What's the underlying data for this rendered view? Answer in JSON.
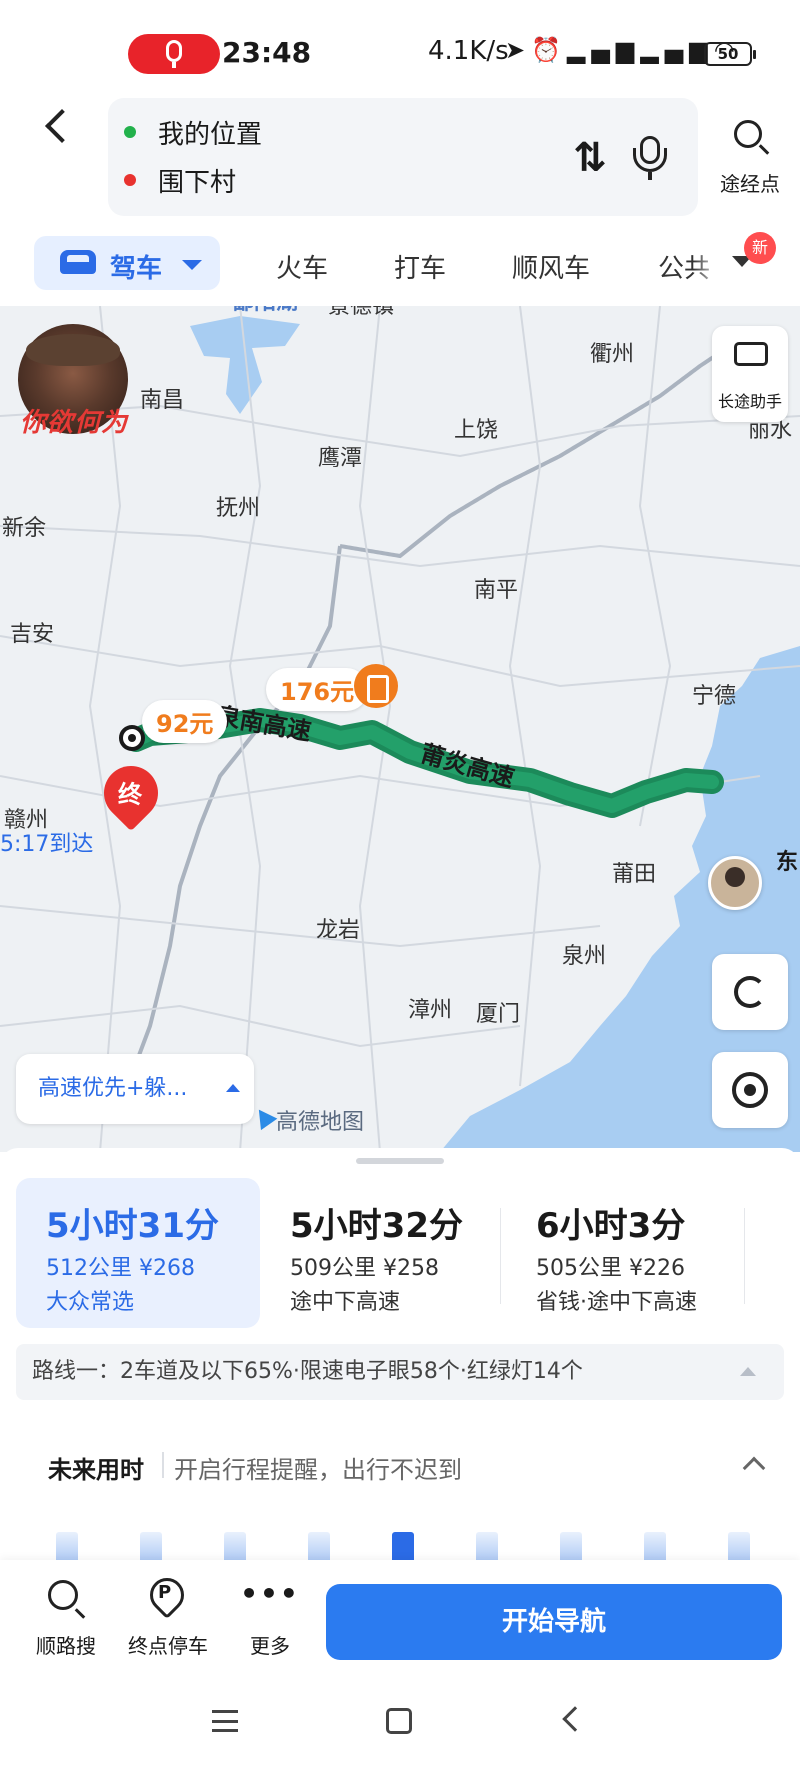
{
  "status_bar": {
    "time": "23:48",
    "net_speed": "4.1K/s",
    "battery": "50",
    "icons": [
      "recording-mic",
      "location-arrow",
      "alarm",
      "signal-hd",
      "signal-hd",
      "wifi",
      "battery"
    ]
  },
  "header": {
    "origin": "我的位置",
    "destination": "围下村",
    "waypoint_label": "途经点",
    "colors": {
      "origin_dot": "#22b14c",
      "destination_dot": "#e8322f"
    }
  },
  "modes": {
    "active": "驾车",
    "items": [
      "火车",
      "打车",
      "顺风车",
      "公共"
    ],
    "badge": "新",
    "accent": "#2b6be6"
  },
  "map": {
    "logo_text": "你欲何为",
    "long_trip_label": "长途助手",
    "brand": "高德地图",
    "preference": "高速优先+躲...",
    "arrival": "5:17到达",
    "dest_marker": "终",
    "tolls": [
      "176元",
      "92元"
    ],
    "roads": [
      "泉南高速",
      "莆炎高速"
    ],
    "east_label": "东",
    "cities": {
      "poyang": "鄱阳湖",
      "jingdezhen": "景德镇",
      "nanchang": "南昌",
      "quzhou": "衢州",
      "shangrao": "上饶",
      "yingtan": "鹰潭",
      "lishui": "丽水",
      "fuzhou_jx": "抚州",
      "xinyu": "新余",
      "nanping": "南平",
      "jian": "吉安",
      "ningde": "宁德",
      "ganzhou": "赣州",
      "putian": "莆田",
      "longyan": "龙岩",
      "quanzhou": "泉州",
      "zhangzhou": "漳州",
      "xiamen": "厦门"
    },
    "colors": {
      "route": "#1c8a5a",
      "sea": "#a8cdf2",
      "land": "#eef1f4",
      "toll": "#f07c1d"
    }
  },
  "routes": [
    {
      "time": "5小时31分",
      "distance": "512公里",
      "cost": "¥268",
      "tag": "大众常选",
      "selected": true
    },
    {
      "time": "5小时32分",
      "distance": "509公里",
      "cost": "¥258",
      "tag": "途中下高速",
      "selected": false
    },
    {
      "time": "6小时3分",
      "distance": "505公里",
      "cost": "¥226",
      "tag": "省钱·途中下高速",
      "selected": false
    }
  ],
  "route_detail": "路线一：2车道及以下65%·限速电子眼58个·红绿灯14个",
  "future": {
    "title": "未来用时",
    "hint": "开启行程提醒，出行不迟到",
    "selected_index": 4,
    "bar_levels": [
      0.6,
      0.6,
      0.6,
      0.6,
      0.6,
      0.6,
      0.6,
      0.6,
      0.6
    ]
  },
  "actions": {
    "search_along": "顺路搜",
    "dest_parking": "终点停车",
    "more": "更多",
    "start_nav": "开始导航"
  }
}
